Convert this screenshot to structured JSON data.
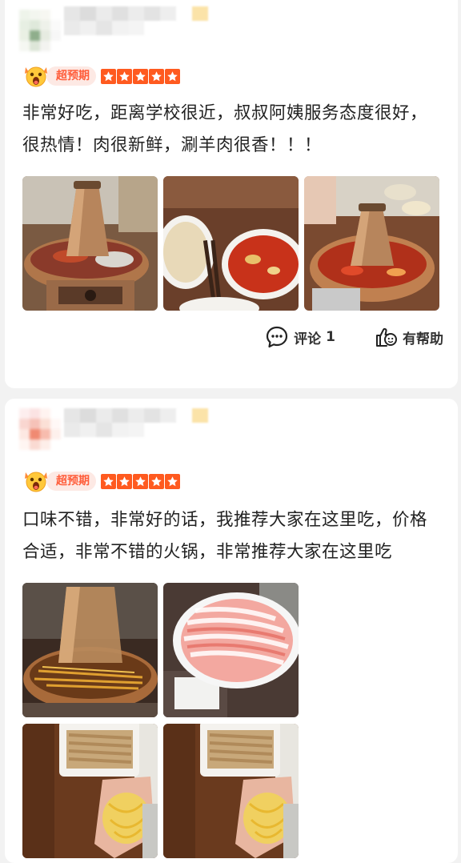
{
  "reviews": [
    {
      "badge": "超预期",
      "rating": 5,
      "text": "非常好吃，距离学校很近，叔叔阿姨服务态度很好，很热情！肉很新鲜，涮羊肉很香！！！",
      "photos": [
        "hotpot-copper-pot-icon",
        "sauce-bowls-icon",
        "hotpot-table-icon"
      ],
      "comment_label": "评论",
      "comment_count": "1",
      "helpful_label": "有帮助"
    },
    {
      "badge": "超预期",
      "rating": 5,
      "text": "口味不错，非常好的话，我推荐大家在这里吃，价格合适，非常不错的火锅，非常推荐大家在这里吃",
      "photos": [
        "hotpot-boiling-icon",
        "lamb-slices-plate-icon",
        "noodles-plate-icon",
        "noodles-plate-icon"
      ]
    }
  ],
  "colors": {
    "accent": "#ff5a1f",
    "badge_text": "#ff5d3a",
    "badge_bg": "#fde9e4"
  }
}
